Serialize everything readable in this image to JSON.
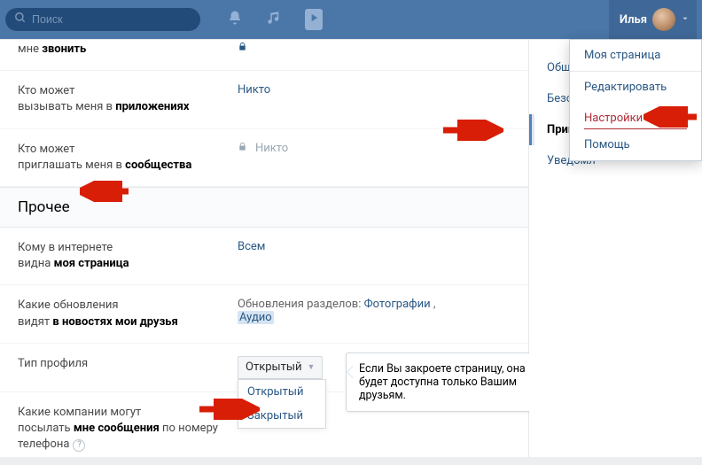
{
  "topbar": {
    "search_placeholder": "Поиск",
    "user_name": "Илья"
  },
  "user_menu": {
    "items": [
      "Моя страница",
      "Редактировать",
      "Настройки",
      "Помощь"
    ],
    "active_index": 2
  },
  "side_tabs": {
    "items": [
      "Общее",
      "Безопасность",
      "Приватность",
      "Уведомления"
    ],
    "shown": [
      "Общее",
      "Безопасн",
      "Приватн",
      "Уведомл"
    ],
    "active_index": 2
  },
  "rows": {
    "call": {
      "label_pre": "мне ",
      "label_bold": "звонить",
      "value": ""
    },
    "apps": {
      "line1_pre": "Кто может",
      "line2_pre": "вызывать меня в ",
      "line2_bold": "приложениях",
      "value": "Никто"
    },
    "communities": {
      "line1_pre": "Кто может",
      "line2_pre": "приглашать меня в ",
      "line2_bold": "сообщества",
      "value": "Никто",
      "locked": true
    },
    "page_visible": {
      "line1_pre": "Кому в интернете",
      "line2_pre": "видна ",
      "line2_bold": "моя страница",
      "value": "Всем"
    },
    "news": {
      "line1_pre": "Какие обновления",
      "line2_pre": "видят ",
      "line2_bold": "в новостях мои друзья",
      "value_prefix": "Обновления разделов:",
      "value_link": "Фотографии",
      "value_comma": ",",
      "value_hl": "Аудио"
    },
    "profile_type": {
      "label": "Тип профиля",
      "selected": "Открытый",
      "options": [
        "Открытый",
        "Закрытый"
      ],
      "tooltip": "Если Вы закроете страницу, она будет доступна только Вашим друзьям."
    },
    "companies": {
      "line1": "Какие компании могут",
      "line2_pre": "посылать ",
      "line2_bold": "мне сообщения",
      "line2_post": " по номеру",
      "line3": "телефона"
    }
  },
  "section_title": "Прочее"
}
